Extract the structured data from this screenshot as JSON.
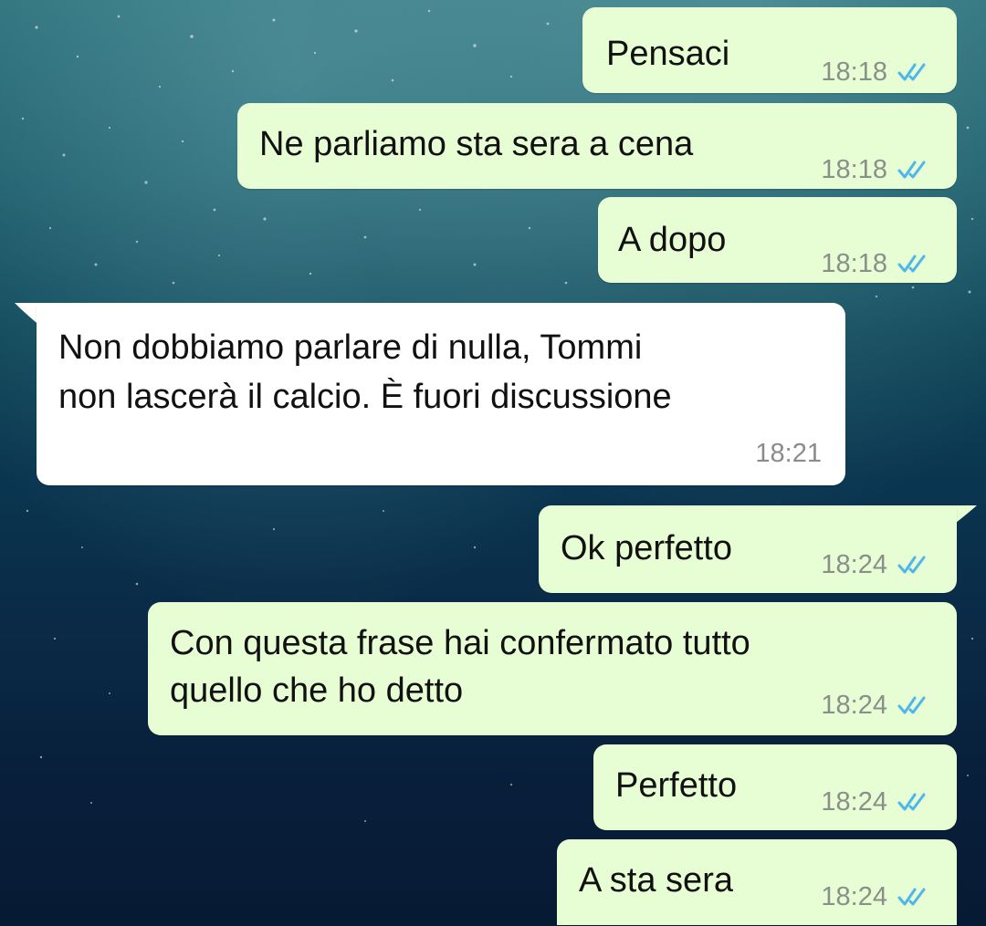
{
  "chat": {
    "messages": [
      {
        "direction": "outgoing",
        "text": "Pensaci",
        "time": "18:18",
        "status": "read",
        "status_icon": "double-check-icon",
        "status_color": "#4fb6ec"
      },
      {
        "direction": "outgoing",
        "text": "Ne parliamo sta sera a cena",
        "time": "18:18",
        "status": "read",
        "status_icon": "double-check-icon",
        "status_color": "#4fb6ec"
      },
      {
        "direction": "outgoing",
        "text": "A dopo",
        "time": "18:18",
        "status": "read",
        "status_icon": "double-check-icon",
        "status_color": "#4fb6ec"
      },
      {
        "direction": "incoming",
        "lines": [
          "Non dobbiamo parlare di nulla, Tommi",
          "non lascerà il calcio. È fuori discussione"
        ],
        "time": "18:21"
      },
      {
        "direction": "outgoing",
        "text": "Ok perfetto",
        "time": "18:24",
        "status": "read",
        "status_icon": "double-check-icon",
        "status_color": "#4fb6ec"
      },
      {
        "direction": "outgoing",
        "lines": [
          "Con questa frase hai confermato tutto",
          "quello che ho detto"
        ],
        "time": "18:24",
        "status": "read",
        "status_icon": "double-check-icon",
        "status_color": "#4fb6ec"
      },
      {
        "direction": "outgoing",
        "text": "Perfetto",
        "time": "18:24",
        "status": "read",
        "status_icon": "double-check-icon",
        "status_color": "#4fb6ec"
      },
      {
        "direction": "outgoing",
        "text": "A sta sera",
        "time": "18:24",
        "status": "read",
        "status_icon": "double-check-icon",
        "status_color": "#4fb6ec"
      }
    ]
  },
  "theme": {
    "outgoing_bubble": "#e7fdd3",
    "incoming_bubble": "#ffffff",
    "timestamp_color": "#8a8f8a",
    "background": "underwater-wallpaper"
  }
}
